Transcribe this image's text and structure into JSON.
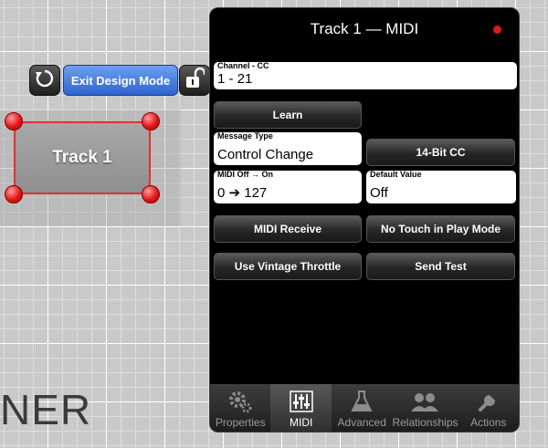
{
  "toolbar": {
    "exit_label": "Exit Design Mode",
    "reset_icon": "reset-icon",
    "lock_icon": "lock-open-icon"
  },
  "canvas": {
    "control_label": "Track 1",
    "background_text": "NER"
  },
  "panel": {
    "title": "Track 1 — MIDI",
    "channel": {
      "label": "Channel - CC",
      "value": "1 - 21"
    },
    "learn_label": "Learn",
    "message_type": {
      "label": "Message Type",
      "value": "Control Change"
    },
    "fourteen_bit_label": "14-Bit CC",
    "midi_off_on": {
      "label": "MIDI Off → On",
      "value": "0 ➔ 127"
    },
    "default_value": {
      "label": "Default Value",
      "value": "Off"
    },
    "midi_receive_label": "MIDI Receive",
    "no_touch_label": "No Touch in Play Mode",
    "vintage_throttle_label": "Use Vintage Throttle",
    "send_test_label": "Send Test"
  },
  "tabs": [
    {
      "label": "Properties",
      "icon": "gears-icon",
      "active": false
    },
    {
      "label": "MIDI",
      "icon": "sliders-icon",
      "active": true
    },
    {
      "label": "Advanced",
      "icon": "flask-icon",
      "active": false
    },
    {
      "label": "Relationships",
      "icon": "people-icon",
      "active": false
    },
    {
      "label": "Actions",
      "icon": "wrench-icon",
      "active": false
    }
  ],
  "colors": {
    "accent_blue": "#3a72de",
    "handle_red": "#e21818",
    "record_dot": "#d91a1a"
  }
}
